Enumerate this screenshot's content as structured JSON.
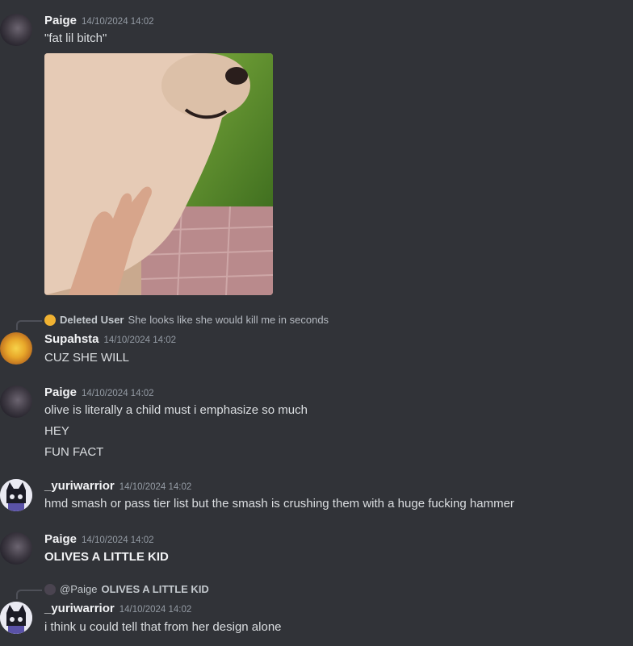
{
  "messages": [
    {
      "author": "Paige",
      "time": "14/10/2024 14:02",
      "lines": [
        "\"fat lil bitch\""
      ]
    },
    {
      "reply": {
        "author": "Deleted User",
        "text": "She looks like she would kill me in seconds"
      },
      "author": "Supahsta",
      "time": "14/10/2024 14:02",
      "lines": [
        "CUZ SHE WILL"
      ]
    },
    {
      "author": "Paige",
      "time": "14/10/2024 14:02",
      "lines": [
        "olive is literally a child must i emphasize so much",
        "HEY",
        "FUN FACT"
      ]
    },
    {
      "author": "_yuriwarrior",
      "time": "14/10/2024 14:02",
      "lines": [
        "hmd smash or pass tier list but the smash is crushing them with a huge fucking hammer"
      ]
    },
    {
      "author": "Paige",
      "time": "14/10/2024 14:02",
      "lines": [
        "OLIVES A LITTLE KID"
      ]
    },
    {
      "reply": {
        "author": "@Paige",
        "text": "OLIVES A LITTLE KID"
      },
      "author": "_yuriwarrior",
      "time": "14/10/2024 14:02",
      "lines": [
        "i think u could tell that from her design alone"
      ]
    }
  ]
}
